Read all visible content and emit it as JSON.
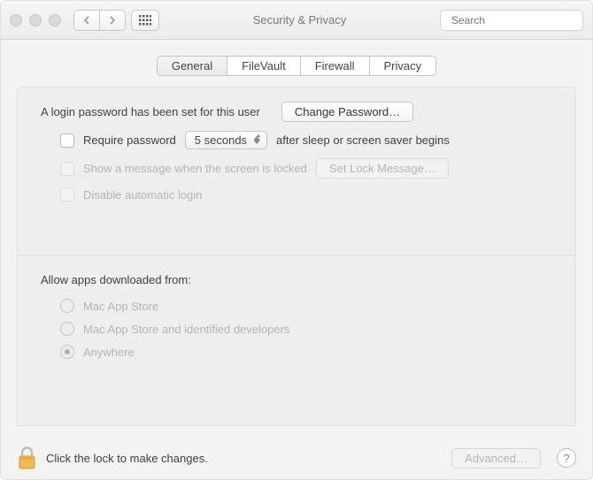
{
  "toolbar": {
    "title": "Security & Privacy",
    "search_placeholder": "Search"
  },
  "tabs": [
    "General",
    "FileVault",
    "Firewall",
    "Privacy"
  ],
  "active_tab": 0,
  "content": {
    "login_msg": "A login password has been set for this user",
    "change_password_btn": "Change Password…",
    "require_password_label": "Require password",
    "require_password_delay": "5 seconds",
    "require_password_after": "after sleep or screen saver begins",
    "show_message_label": "Show a message when the screen is locked",
    "set_lock_message_btn": "Set Lock Message…",
    "disable_auto_login_label": "Disable automatic login",
    "allow_apps_header": "Allow apps downloaded from:",
    "radio_options": [
      "Mac App Store",
      "Mac App Store and identified developers",
      "Anywhere"
    ],
    "radio_selected": 2
  },
  "footer": {
    "lock_msg": "Click the lock to make changes.",
    "advanced_btn": "Advanced…"
  }
}
